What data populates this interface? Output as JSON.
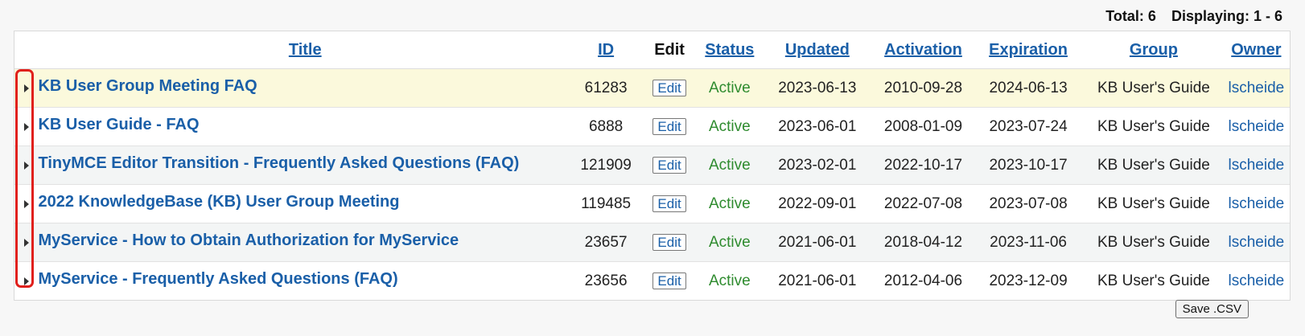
{
  "summary": {
    "total": "Total: 6",
    "displaying": "Displaying: 1 - 6"
  },
  "columns": {
    "title": "Title",
    "id": "ID",
    "edit": "Edit",
    "status": "Status",
    "updated": "Updated",
    "activation": "Activation",
    "expiration": "Expiration",
    "group": "Group",
    "owner": "Owner"
  },
  "rows": [
    {
      "title": "KB User Group Meeting FAQ",
      "id": "61283",
      "edit": "Edit",
      "status": "Active",
      "updated": "2023-06-13",
      "activation": "2010-09-28",
      "expiration": "2024-06-13",
      "group": "KB User's Guide",
      "owner": "lscheide"
    },
    {
      "title": "KB User Guide - FAQ",
      "id": "6888",
      "edit": "Edit",
      "status": "Active",
      "updated": "2023-06-01",
      "activation": "2008-01-09",
      "expiration": "2023-07-24",
      "group": "KB User's Guide",
      "owner": "lscheide"
    },
    {
      "title": "TinyMCE Editor Transition - Frequently Asked Questions (FAQ)",
      "id": "121909",
      "edit": "Edit",
      "status": "Active",
      "updated": "2023-02-01",
      "activation": "2022-10-17",
      "expiration": "2023-10-17",
      "group": "KB User's Guide",
      "owner": "lscheide"
    },
    {
      "title": "2022 KnowledgeBase (KB) User Group Meeting",
      "id": "119485",
      "edit": "Edit",
      "status": "Active",
      "updated": "2022-09-01",
      "activation": "2022-07-08",
      "expiration": "2023-07-08",
      "group": "KB User's Guide",
      "owner": "lscheide"
    },
    {
      "title": "MyService - How to Obtain Authorization for MyService",
      "id": "23657",
      "edit": "Edit",
      "status": "Active",
      "updated": "2021-06-01",
      "activation": "2018-04-12",
      "expiration": "2023-11-06",
      "group": "KB User's Guide",
      "owner": "lscheide"
    },
    {
      "title": "MyService - Frequently Asked Questions (FAQ)",
      "id": "23656",
      "edit": "Edit",
      "status": "Active",
      "updated": "2021-06-01",
      "activation": "2012-04-06",
      "expiration": "2023-12-09",
      "group": "KB User's Guide",
      "owner": "lscheide"
    }
  ],
  "icons": {
    "expand": "caret-right-icon"
  },
  "colors": {
    "link": "#1a5fa8",
    "status_active": "#2e8b2e",
    "highlight_row": "#fbf9dc",
    "annotation": "#e0201c"
  },
  "actions": {
    "save_csv": "Save .CSV"
  }
}
